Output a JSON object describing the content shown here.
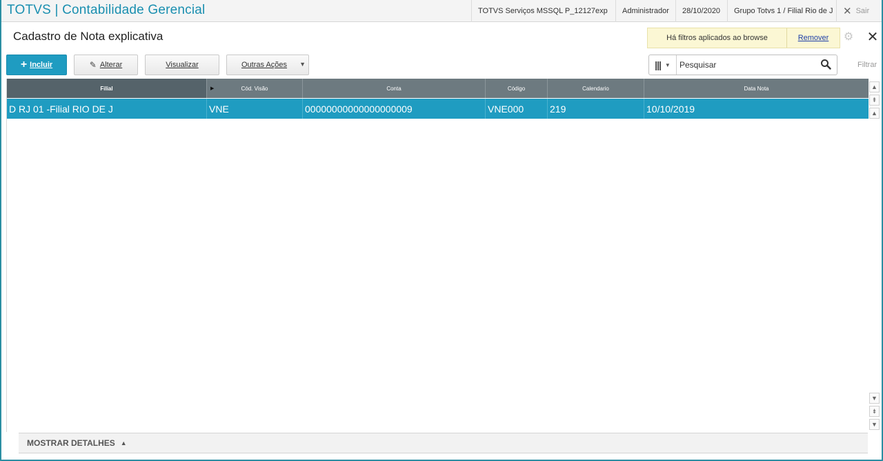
{
  "app": {
    "title": "TOTVS | Contabilidade Gerencial"
  },
  "topbar": {
    "environment": "TOTVS Serviços MSSQL P_12127exp",
    "user": "Administrador",
    "date": "28/10/2020",
    "branch": "Grupo Totvs 1 / Filial Rio de J",
    "exit_label": "Sair"
  },
  "page": {
    "title": "Cadastro de Nota explicativa"
  },
  "filter_notice": {
    "message": "Há filtros aplicados ao browse",
    "remove_label": "Remover"
  },
  "toolbar": {
    "include_label": "Incluir",
    "edit_label": "Alterar",
    "view_label": "Visualizar",
    "other_label": "Outras Ações"
  },
  "search": {
    "placeholder": "Pesquisar",
    "filter_label": "Filtrar"
  },
  "grid": {
    "columns": [
      "Filial",
      "Cód. Visão",
      "Conta",
      "Código",
      "Calendario",
      "Data Nota"
    ],
    "rows": [
      [
        "D RJ 01 -Filial RIO DE J",
        "VNE",
        "00000000000000000009",
        "VNE000",
        "219",
        "10/10/2019"
      ]
    ]
  },
  "details": {
    "label": "MOSTRAR DETALHES"
  },
  "icons": {
    "include": "plus-icon",
    "edit": "pencil-icon",
    "columns": "columns-icon",
    "search": "magnifier-icon",
    "settings": "gear-icon",
    "close": "close-icon"
  },
  "colors": {
    "accent": "#1f9cc1",
    "header": "#6d7a80",
    "notice": "#fbf7d4"
  }
}
